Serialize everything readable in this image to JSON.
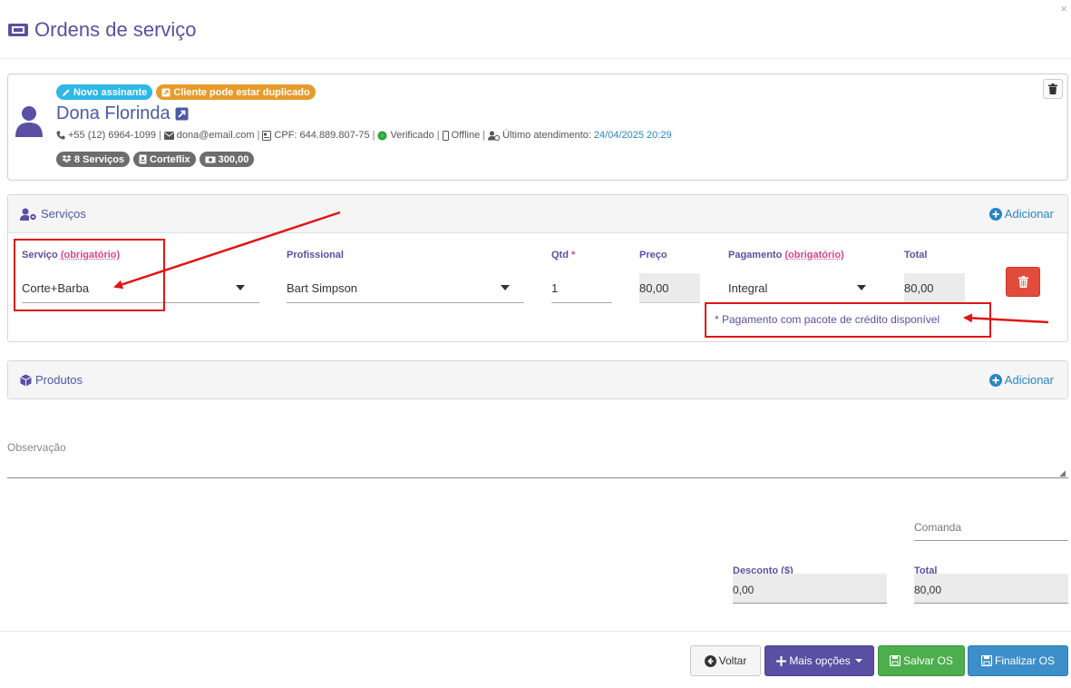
{
  "header": {
    "title": "Ordens de serviço",
    "close_label": "×"
  },
  "client": {
    "badge_new": "Novo assinante",
    "badge_duplicate": "Cliente pode estar duplicado",
    "name": "Dona Florinda",
    "phone": "+55 (12) 6964-1099",
    "email": "dona@email.com",
    "cpf": "CPF: 644.889.807-75",
    "verified": "Verificado",
    "status": "Offline",
    "last_visit_label": "Último atendimento:",
    "last_visit_value": "24/04/2025 20:29",
    "tag_services": "8 Serviços",
    "tag_plan": "Corteflix",
    "tag_balance": "300,00"
  },
  "services": {
    "title": "Serviços",
    "add_label": "Adicionar",
    "col_service": "Serviço",
    "col_required": "(obrigatório)",
    "col_professional": "Profissional",
    "col_qty": "Qtd",
    "col_qty_required": "*",
    "col_price": "Preço",
    "col_payment": "Pagamento",
    "col_total": "Total",
    "row": {
      "service": "Corte+Barba",
      "professional": "Bart Simpson",
      "qty": "1",
      "price": "80,00",
      "payment": "Integral",
      "total": "80,00"
    },
    "note": "* Pagamento com pacote de crédito disponível"
  },
  "products": {
    "title": "Produtos",
    "add_label": "Adicionar"
  },
  "observation": {
    "placeholder": "Observação"
  },
  "comanda": {
    "placeholder": "Comanda"
  },
  "summary": {
    "discount_label": "Desconto ($)",
    "discount_value": "0,00",
    "total_label": "Total",
    "total_value": "80,00"
  },
  "footer": {
    "back_label": "Voltar",
    "more_label": "Mais opções",
    "save_label": "Salvar OS",
    "finish_label": "Finalizar OS"
  },
  "colors": {
    "accent": "#5b4fa3",
    "danger": "#e34b3c",
    "success": "#4cae4c",
    "primary": "#3d8fc9",
    "annotation": "#e01515"
  }
}
